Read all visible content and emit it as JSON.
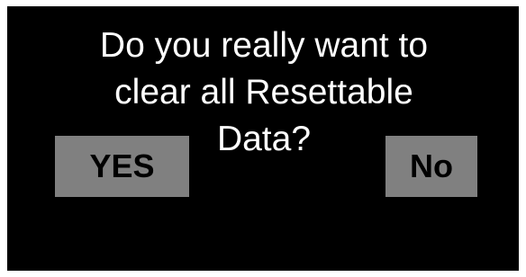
{
  "dialog": {
    "line1": "Do you really want to",
    "line2": "clear all Resettable",
    "line3": "Data?"
  },
  "buttons": {
    "yes_label": "YES",
    "no_label": "No"
  },
  "colors": {
    "background": "#000000",
    "button": "#808080",
    "text": "#ffffff",
    "button_text": "#000000"
  }
}
